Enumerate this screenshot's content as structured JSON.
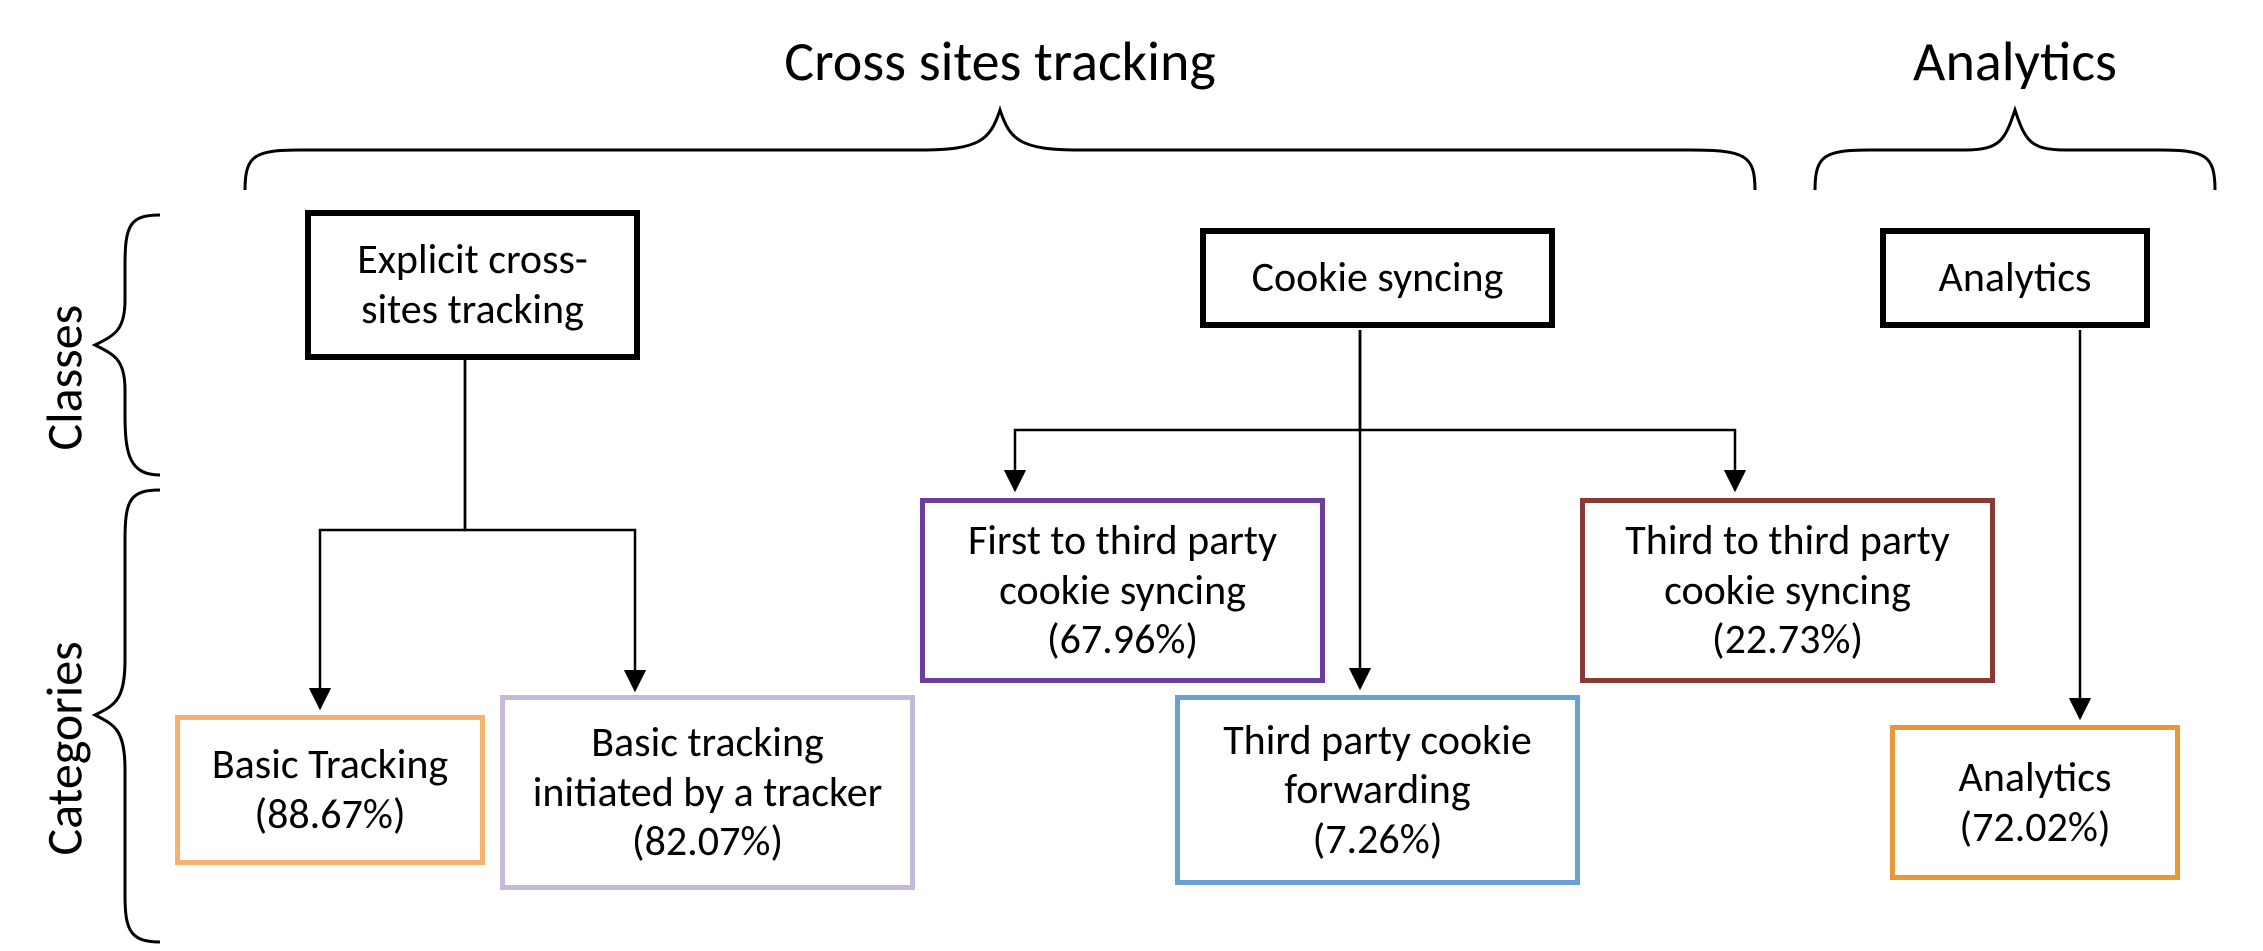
{
  "groups": {
    "cross_sites_tracking": "Cross sites tracking",
    "analytics": "Analytics"
  },
  "rows": {
    "classes": "Classes",
    "categories": "Categories"
  },
  "classes": {
    "explicit": {
      "line1": "Explicit cross-",
      "line2": "sites tracking"
    },
    "cookie_syncing": {
      "line1": "Cookie syncing"
    },
    "analytics": {
      "line1": "Analytics"
    }
  },
  "categories": {
    "basic_tracking": {
      "line1": "Basic Tracking",
      "line2": "(88.67%)",
      "color": "#f4b26d"
    },
    "basic_tracking_initiated": {
      "line1": "Basic tracking",
      "line2": "initiated by a tracker",
      "line3": "(82.07%)",
      "color": "#c6b8d9"
    },
    "first_to_third": {
      "line1": "First to third party",
      "line2": "cookie syncing",
      "line3": "(67.96%)",
      "color": "#6b3e9c"
    },
    "third_forwarding": {
      "line1": "Third  party cookie",
      "line2": "forwarding",
      "line3": "(7.26%)",
      "color": "#6aa0d8"
    },
    "third_to_third": {
      "line1": "Third to third party",
      "line2": "cookie syncing",
      "line3": "(22.73%)",
      "color": "#8a3a34"
    },
    "analytics_cat": {
      "line1": "Analytics",
      "line2": "(72.02%)",
      "color": "#e99838"
    }
  }
}
